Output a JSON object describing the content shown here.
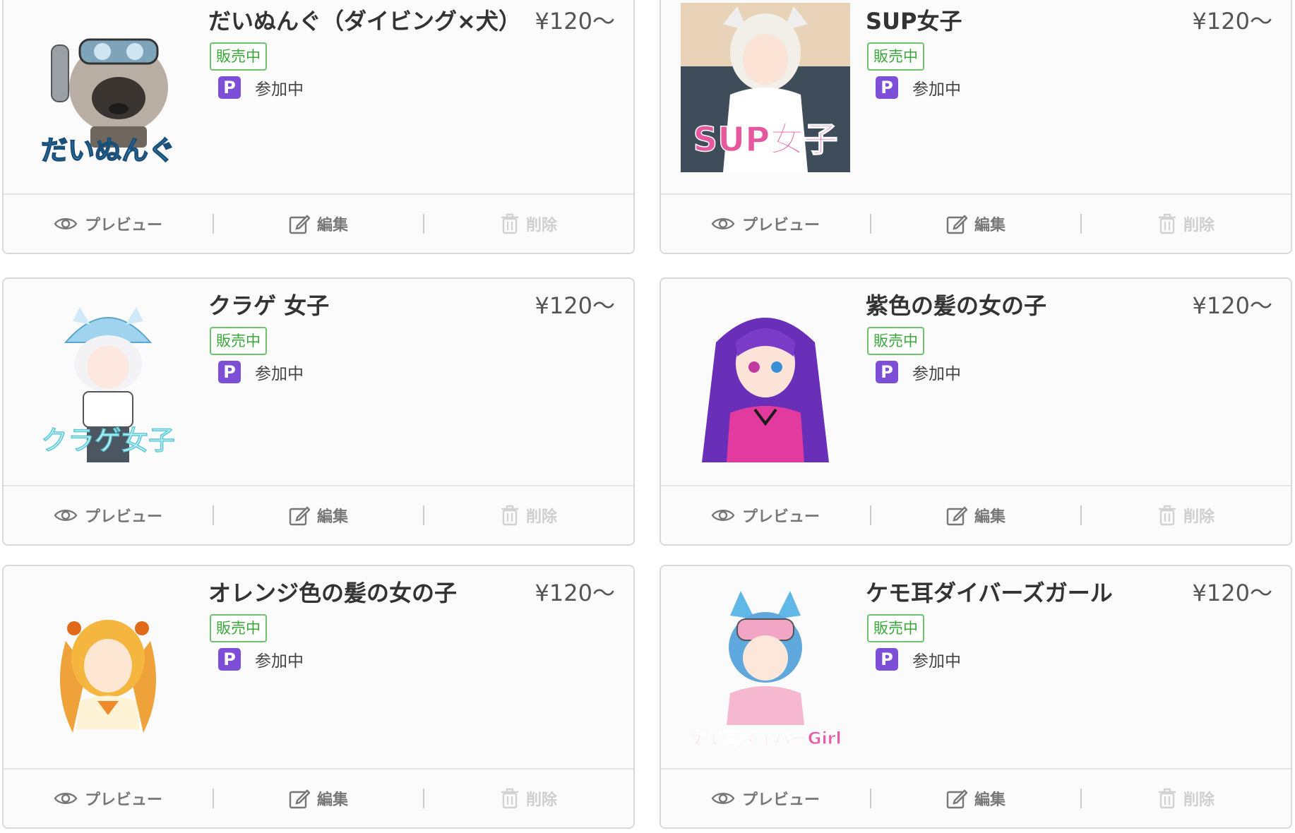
{
  "colors": {
    "status_green": "#3aa83a",
    "point_purple": "#7c4fd6",
    "border": "#d9d9d9",
    "delete_disabled": "#cfcfcf"
  },
  "actions": {
    "preview_label": "プレビュー",
    "edit_label": "編集",
    "delete_label": "削除",
    "preview_icon": "eye-icon",
    "edit_icon": "edit-icon",
    "delete_icon": "trash-icon"
  },
  "products": [
    {
      "title": "だいぬんぐ（ダイビング×犬）",
      "price": "¥120〜",
      "status": "販売中",
      "point_badge": "P",
      "point_status": "参加中",
      "thumbnail_caption": "だいぬんぐ",
      "thumbnail_icon": "pug-diver-illustration"
    },
    {
      "title": "SUP女子",
      "price": "¥120〜",
      "status": "販売中",
      "point_badge": "P",
      "point_status": "参加中",
      "thumbnail_caption": "SUP女子",
      "thumbnail_icon": "sup-girl-illustration"
    },
    {
      "title": "クラゲ 女子",
      "price": "¥120〜",
      "status": "販売中",
      "point_badge": "P",
      "point_status": "参加中",
      "thumbnail_caption": "クラゲ女子",
      "thumbnail_icon": "jellyfish-girl-illustration"
    },
    {
      "title": "紫色の髪の女の子",
      "price": "¥120〜",
      "status": "販売中",
      "point_badge": "P",
      "point_status": "参加中",
      "thumbnail_caption": "",
      "thumbnail_icon": "purple-hair-girl-illustration"
    },
    {
      "title": "オレンジ色の髪の女の子",
      "price": "¥120〜",
      "status": "販売中",
      "point_badge": "P",
      "point_status": "参加中",
      "thumbnail_caption": "",
      "thumbnail_icon": "orange-hair-girl-illustration"
    },
    {
      "title": "ケモ耳ダイバーズガール",
      "price": "¥120〜",
      "status": "販売中",
      "point_badge": "P",
      "point_status": "参加中",
      "thumbnail_caption": "ケモ耳ダイバーGirl",
      "thumbnail_icon": "kemomimi-diver-girl-illustration"
    }
  ]
}
